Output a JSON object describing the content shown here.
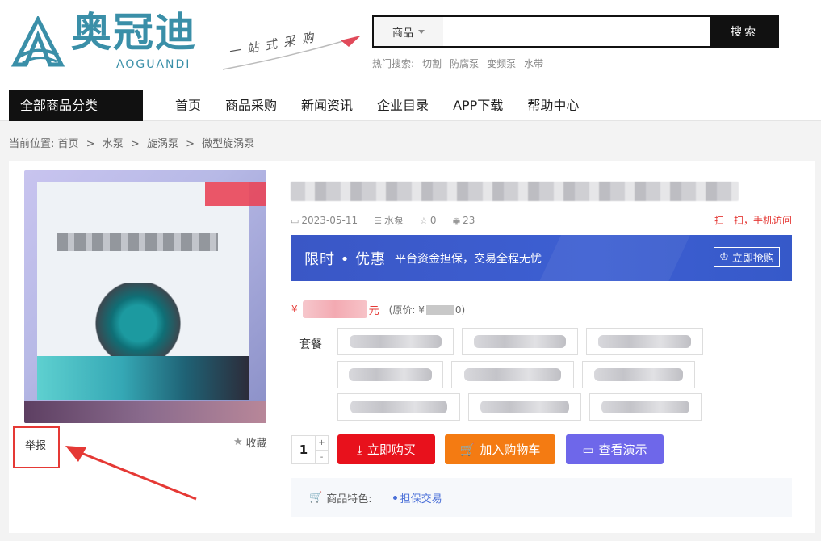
{
  "brand": {
    "name_cn": "奥冠迪",
    "name_en": "AOGUANDI",
    "slogan": "一站式采购"
  },
  "search": {
    "category": "商品",
    "placeholder": "",
    "button": "搜索"
  },
  "hot_search": {
    "label": "热门搜索:",
    "items": [
      "切割",
      "防腐泵",
      "变频泵",
      "水带"
    ]
  },
  "nav": {
    "all_categories": "全部商品分类",
    "items": [
      "首页",
      "商品采购",
      "新闻资讯",
      "企业目录",
      "APP下载",
      "帮助中心"
    ]
  },
  "breadcrumb": {
    "label": "当前位置:",
    "items": [
      "首页",
      "水泵",
      "旋涡泵",
      "微型旋涡泵"
    ],
    "separator": ">"
  },
  "product": {
    "report": "举报",
    "favorite": "收藏",
    "date": "2023-05-11",
    "category": "水泵",
    "stars": "0",
    "views": "23",
    "scan_text": "扫一扫，手机访问",
    "promo": {
      "title": "限时 • 优惠",
      "text": "平台资金担保，交易全程无忧",
      "button": "立即抢购"
    },
    "price": {
      "currency": "¥",
      "dot": ".",
      "unit": "元",
      "orig_prefix": "(原价: ¥",
      "orig_suffix": "0)"
    },
    "package_label": "套餐",
    "quantity": "1",
    "actions": {
      "buy": "立即购买",
      "cart": "加入购物车",
      "demo": "查看演示"
    },
    "features": {
      "label": "商品特色:",
      "items": [
        "担保交易"
      ]
    }
  },
  "colors": {
    "brand_teal": "#3a8fa8",
    "promo_blue": "#3d5fd2",
    "buy_red": "#e8111c",
    "cart_orange": "#f47b12",
    "demo_purple": "#6e67ea",
    "alert_red": "#e53935"
  }
}
